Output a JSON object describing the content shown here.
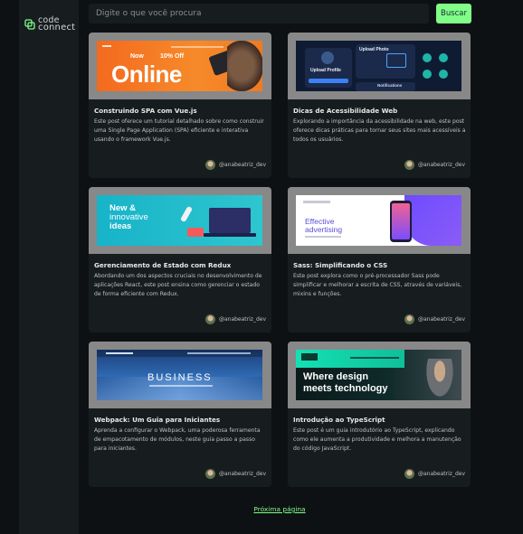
{
  "brand": {
    "line1": "code",
    "line2": "connect",
    "accent": "#81fe88"
  },
  "search": {
    "placeholder": "Digite o que você procura",
    "button": "Buscar"
  },
  "cards": [
    {
      "title": "Construindo SPA com Vue.js",
      "description": "Este post oferece um tutorial detalhado sobre como construir uma Single Page Application (SPA) eficiente e interativa usando o framework Vue.js.",
      "author": "@anabeatriz_dev",
      "thumb": {
        "line1": "Now",
        "line2": "10% Off",
        "line3": "Online"
      }
    },
    {
      "title": "Dicas de Acessibilidade Web",
      "description": "Explorando a importância da acessibilidade na web, este post oferece dicas práticas para tornar seus sites mais acessíveis a todos os usuários.",
      "author": "@anabeatriz_dev",
      "thumb": {
        "line1": "Upload Profile",
        "line2": "Upload Photo",
        "line3": "Notifications"
      }
    },
    {
      "title": "Gerenciamento de Estado com Redux",
      "description": "Abordando um dos aspectos cruciais no desenvolvimento de aplicações React, este post ensina como gerenciar o estado de forma eficiente com Redux.",
      "author": "@anabeatriz_dev",
      "thumb": {
        "line1": "New &",
        "line2": "innovative",
        "line3": "ideas"
      }
    },
    {
      "title": "Sass: Simplificando o CSS",
      "description": "Este post explora como o pré-processador Sass pode simplificar e melhorar a escrita de CSS, através de variáveis, mixins e funções.",
      "author": "@anabeatriz_dev",
      "thumb": {
        "line1": "Effective",
        "line2": "advertising"
      }
    },
    {
      "title": "Webpack: Um Guia para Iniciantes",
      "description": "Aprenda a configurar o Webpack, uma poderosa ferramenta de empacotamento de módulos, neste guia passo a passo para iniciantes.",
      "author": "@anabeatriz_dev",
      "thumb": {
        "line1": "BUSINESS"
      }
    },
    {
      "title": "Introdução ao TypeScript",
      "description": "Este post é um guia introdutório ao TypeScript, explicando como ele aumenta a produtividade e melhora a manutenção do código JavaScript.",
      "author": "@anabeatriz_dev",
      "thumb": {
        "line1": "Where design",
        "line2": "meets technology"
      }
    }
  ],
  "pagination": {
    "next": "Próxima página"
  }
}
